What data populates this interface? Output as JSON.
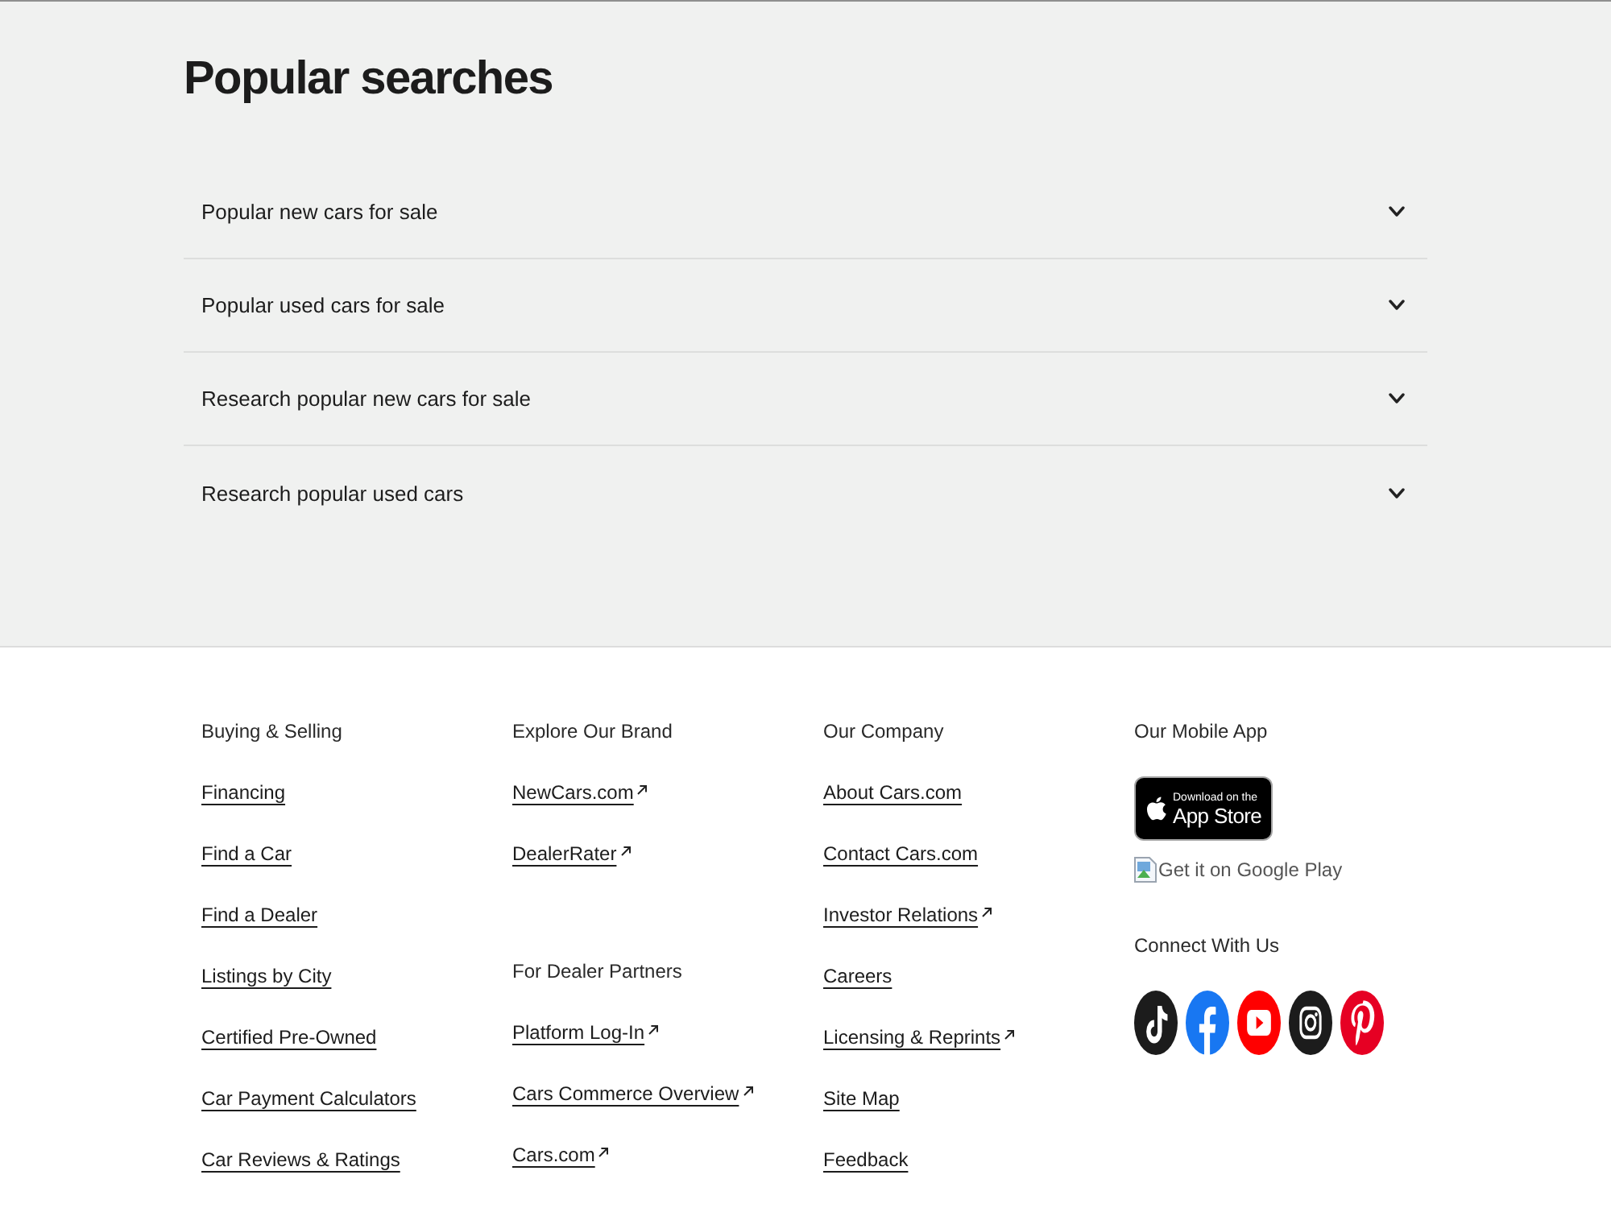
{
  "popular_searches": {
    "title": "Popular searches",
    "items": [
      {
        "label": "Popular new cars for sale",
        "expanded": false
      },
      {
        "label": "Popular used cars for sale",
        "expanded": false
      },
      {
        "label": "Research popular new cars for sale",
        "expanded": false
      },
      {
        "label": "Research popular used cars",
        "expanded": false
      }
    ]
  },
  "footer": {
    "link_columns": [
      {
        "sections": [
          {
            "heading": "Buying & Selling",
            "links": [
              {
                "label": "Financing",
                "external": false
              },
              {
                "label": "Find a Car",
                "external": false
              },
              {
                "label": "Find a Dealer",
                "external": false
              },
              {
                "label": "Listings by City",
                "external": false
              },
              {
                "label": "Certified Pre-Owned",
                "external": false
              },
              {
                "label": "Car Payment Calculators",
                "external": false
              },
              {
                "label": "Car Reviews & Ratings",
                "external": false
              }
            ]
          }
        ]
      },
      {
        "sections": [
          {
            "heading": "Explore Our Brand",
            "links": [
              {
                "label": "NewCars.com",
                "external": true
              },
              {
                "label": "DealerRater",
                "external": true
              }
            ]
          },
          {
            "heading": "For Dealer Partners",
            "links": [
              {
                "label": "Platform Log-In",
                "external": true
              },
              {
                "label": "Cars Commerce Overview",
                "external": true
              },
              {
                "label": "Cars.com",
                "external": true
              }
            ]
          }
        ]
      },
      {
        "sections": [
          {
            "heading": "Our Company",
            "links": [
              {
                "label": "About Cars.com",
                "external": false
              },
              {
                "label": "Contact Cars.com",
                "external": false
              },
              {
                "label": "Investor Relations",
                "external": true
              },
              {
                "label": "Careers",
                "external": false
              },
              {
                "label": "Licensing & Reprints",
                "external": true
              },
              {
                "label": "Site Map",
                "external": false
              },
              {
                "label": "Feedback",
                "external": false
              }
            ]
          }
        ]
      }
    ],
    "mobile_app": {
      "heading": "Our Mobile App",
      "app_store_badge": {
        "caption": "Download on the",
        "title": "App Store"
      },
      "google_play_image": {
        "alt_text": "Get it on Google Play"
      }
    },
    "connect": {
      "heading": "Connect With Us",
      "social": [
        {
          "kind": "tiktok",
          "color": "#1c1c1c"
        },
        {
          "kind": "facebook",
          "color": "#1877f2"
        },
        {
          "kind": "youtube",
          "color": "#ff0000"
        },
        {
          "kind": "instagram",
          "color": "#1c1c1c"
        },
        {
          "kind": "pinterest",
          "color": "#e60023"
        }
      ]
    }
  }
}
